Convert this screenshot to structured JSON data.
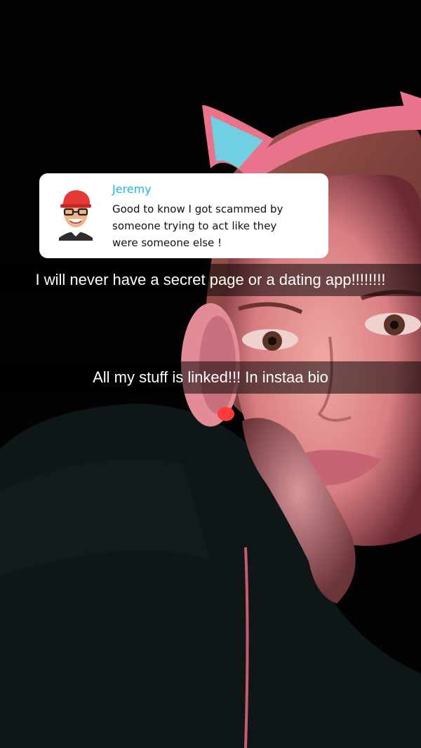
{
  "reply": {
    "sender_name": "Jeremy",
    "message_lines": [
      "Good to know I got scammed by",
      "someone trying to act like they",
      "were someone else !"
    ],
    "avatar_icon": "bitmoji-avatar-icon"
  },
  "captions": [
    "I will never have a secret page or a dating app!!!!!!!!",
    "All my stuff is linked!!! In instaa bio"
  ],
  "colors": {
    "name_accent": "#18b7e8",
    "headset_pink": "#e8738a",
    "ear_glow_blue": "#5ae0f0"
  }
}
